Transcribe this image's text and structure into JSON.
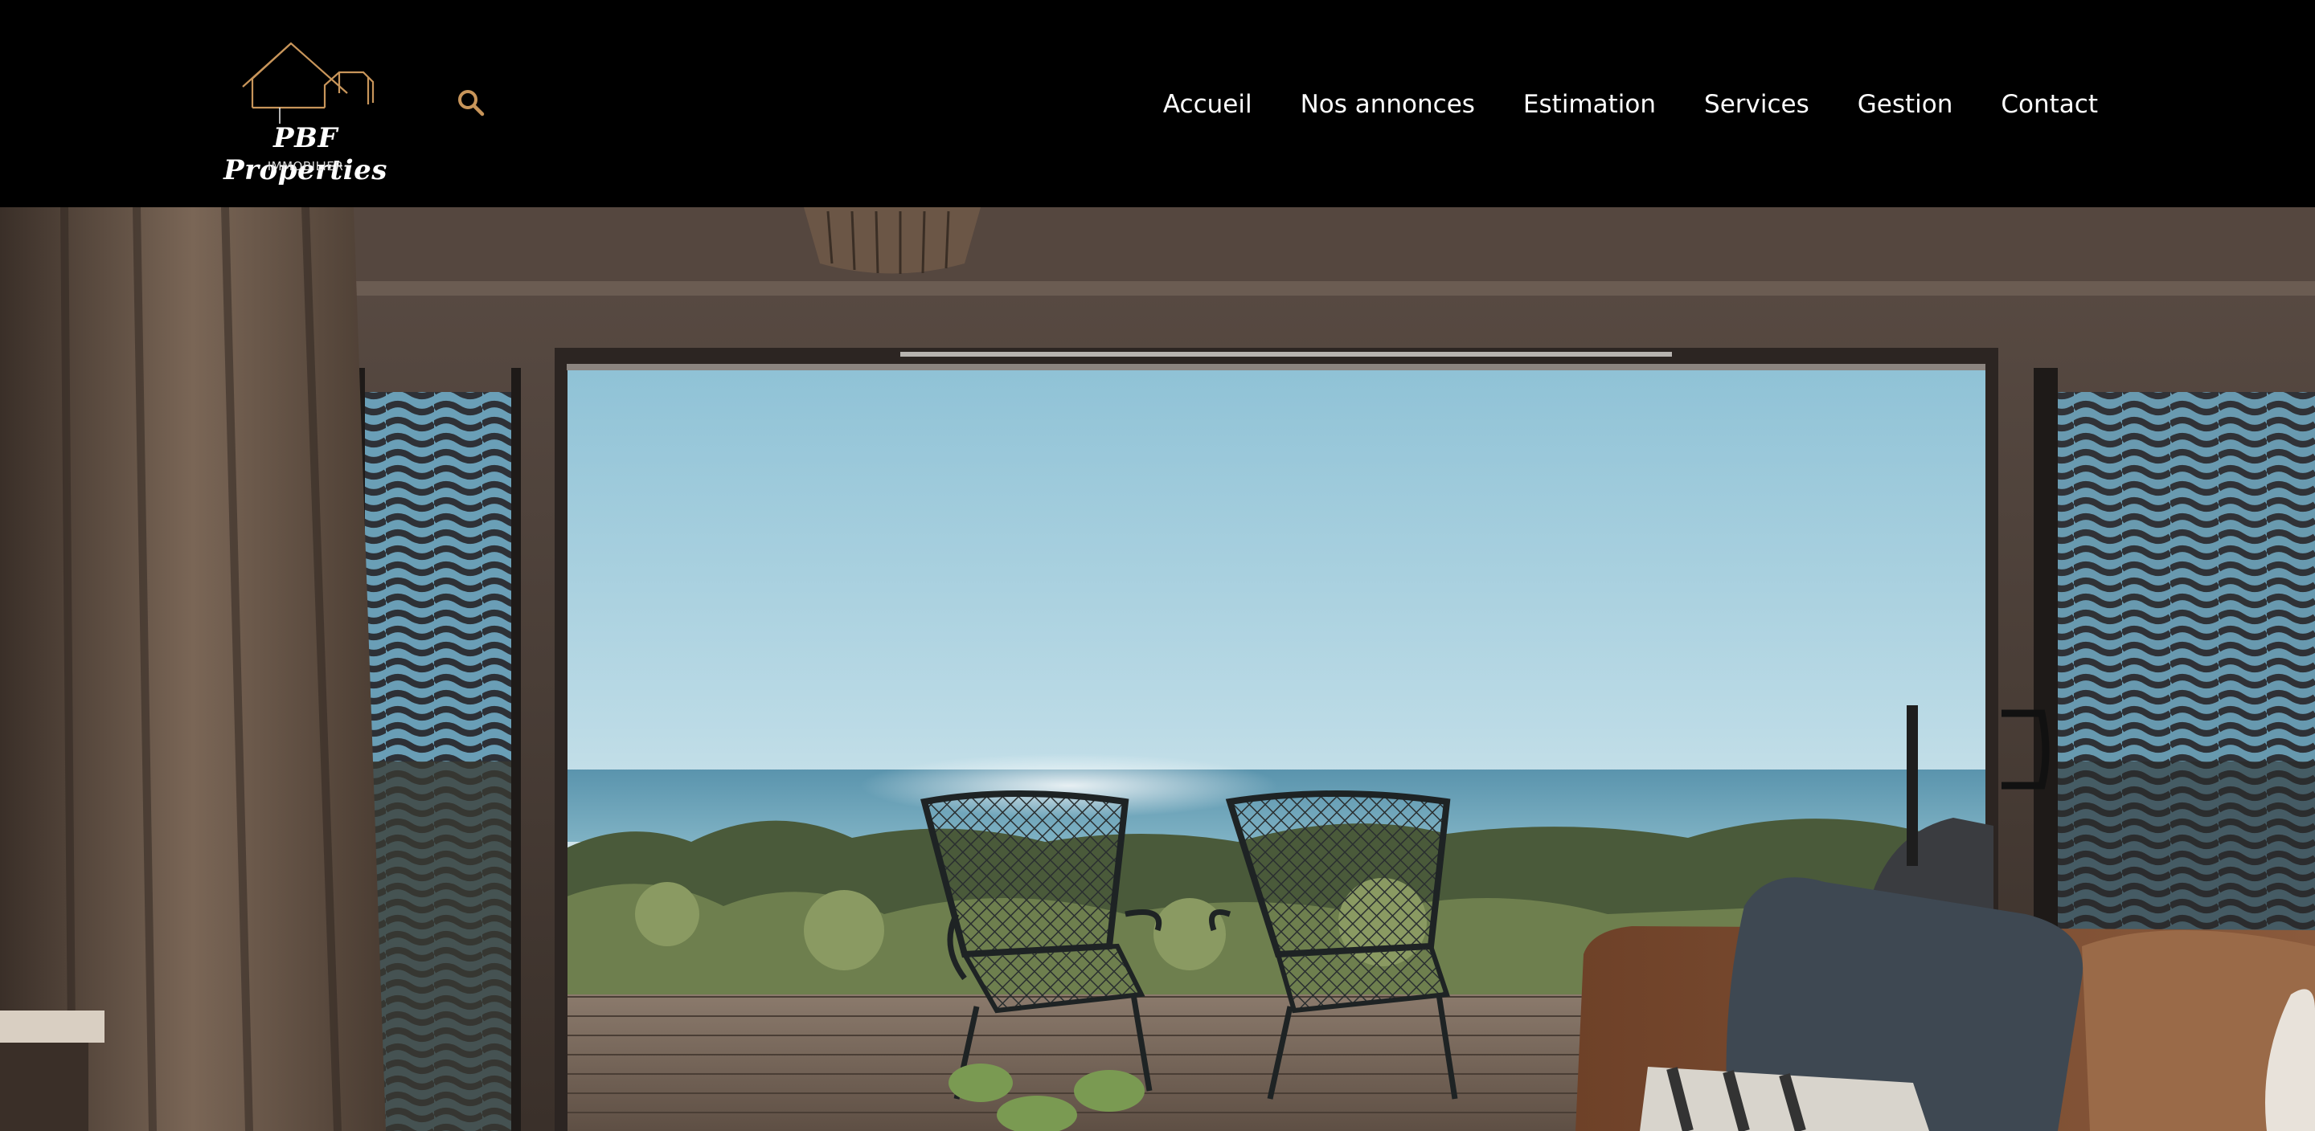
{
  "brand": {
    "name": "PBF Properties",
    "subtitle": "IMMOBILIER",
    "accent_color": "#C8955A",
    "logo_icon": "house-outline-icon"
  },
  "search": {
    "icon": "search-icon"
  },
  "nav": {
    "items": [
      {
        "label": "Accueil"
      },
      {
        "label": "Nos annonces"
      },
      {
        "label": "Estimation"
      },
      {
        "label": "Services"
      },
      {
        "label": "Gestion"
      },
      {
        "label": "Contact"
      }
    ]
  },
  "hero": {
    "image": "ocean-view-terrace-with-two-chairs"
  },
  "colors": {
    "header_bg": "#000000",
    "nav_text": "#FFFFFF"
  }
}
